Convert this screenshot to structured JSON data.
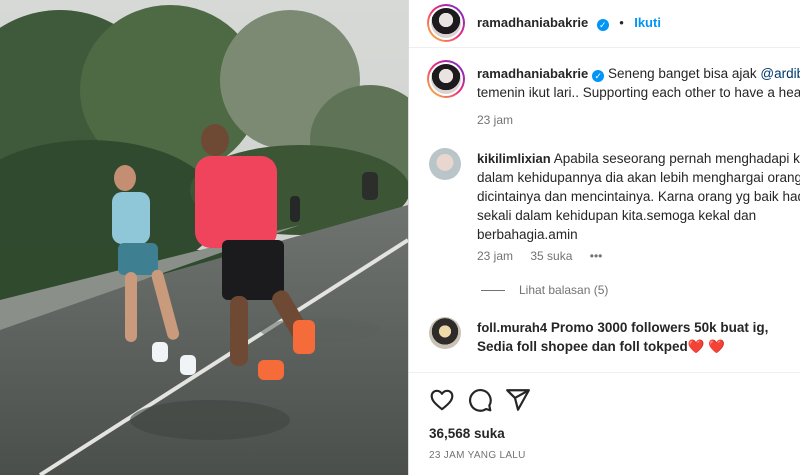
{
  "post": {
    "author": "ramadhaniabakrie",
    "follow_label": "Ikuti",
    "dot": "•",
    "caption_text": "Seneng banget bisa ajak ",
    "caption_mention": "@ardibak",
    "caption_line2": "temenin ikut lari.. Supporting each other to have a health",
    "caption_time": "23 jam",
    "likes": "36,568 suka",
    "posted_ago": "23 JAM YANG LALU"
  },
  "comments": [
    {
      "user": "kikilimlixian",
      "lines": [
        "Apabila seseorang pernah menghadapi kesu",
        "dalam kehidupannya dia akan lebih menghargai orang y",
        "dicintainya dan mencintainya. Karna orang yg baik hadir",
        "sekali dalam kehidupan kita.semoga kekal dan",
        "berbahagia.amin"
      ],
      "time": "23 jam",
      "likes": "35 suka",
      "more": "•••",
      "view_replies": "Lihat balasan (5)"
    },
    {
      "user": "foll.murah4",
      "line1": "Promo 3000 followers 50k buat ig,",
      "line2": "Sedia foll shopee dan foll tokped",
      "hearts": "❤️ ❤️"
    }
  ],
  "icons": [
    "verified-badge-icon",
    "heart-icon",
    "comment-icon",
    "share-icon"
  ],
  "colors": {
    "link": "#0095f6",
    "text": "#262626",
    "muted": "#737373",
    "verified": "#0095f6"
  }
}
